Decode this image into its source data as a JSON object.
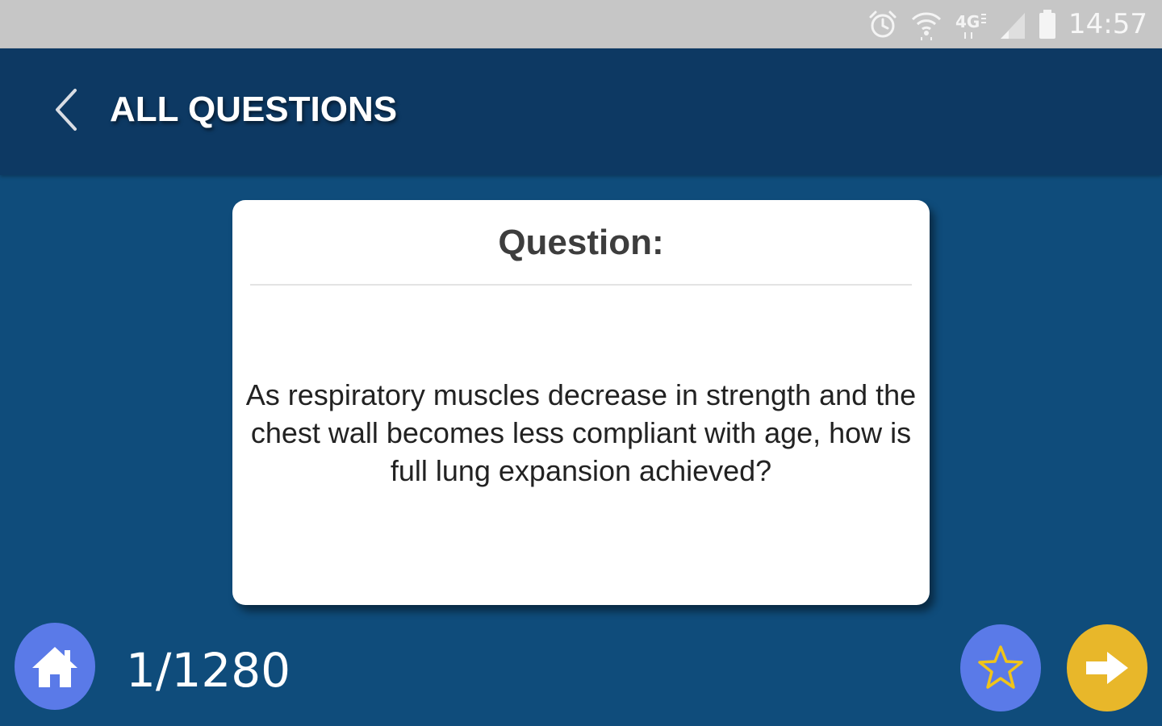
{
  "status_bar": {
    "time": "14:57",
    "network_label": "4G",
    "icons": [
      "alarm-icon",
      "wifi-icon",
      "network-4g-icon",
      "signal-icon",
      "battery-icon"
    ]
  },
  "header": {
    "title": "ALL QUESTIONS",
    "back_icon": "chevron-left-icon"
  },
  "card": {
    "heading": "Question:",
    "question": "As respiratory muscles decrease in strength and the chest wall becomes less compliant with age, how is full lung expansion achieved?"
  },
  "footer": {
    "counter": "1/1280",
    "home_icon": "home-icon",
    "favorite_icon": "star-icon",
    "next_icon": "arrow-right-icon"
  },
  "colors": {
    "background": "#0f4c7b",
    "header": "#0d3963",
    "status_bar": "#c6c6c6",
    "card": "#ffffff",
    "action_blue": "#5a7ae8",
    "action_yellow": "#e8b72a",
    "star_outline": "#f0c419"
  }
}
